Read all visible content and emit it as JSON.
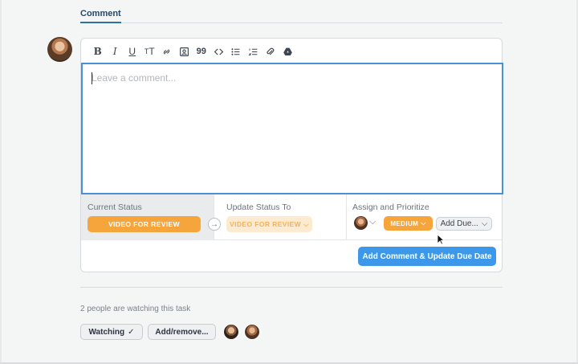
{
  "tabs": {
    "active": "Comment"
  },
  "toolbar": {
    "tools": [
      {
        "name": "bold-icon",
        "glyph": "B"
      },
      {
        "name": "italic-icon",
        "glyph": "I"
      },
      {
        "name": "underline-icon",
        "glyph": "U"
      },
      {
        "name": "text-size-icon",
        "glyph": "TT"
      },
      {
        "name": "link-icon",
        "glyph": "link"
      },
      {
        "name": "image-icon",
        "glyph": "img"
      },
      {
        "name": "quote-icon",
        "glyph": "99"
      },
      {
        "name": "code-icon",
        "glyph": "<>"
      },
      {
        "name": "bullet-list-icon",
        "glyph": "ul"
      },
      {
        "name": "numbered-list-icon",
        "glyph": "ol"
      },
      {
        "name": "attachment-icon",
        "glyph": "clip"
      },
      {
        "name": "google-drive-icon",
        "glyph": "drive"
      }
    ]
  },
  "editor": {
    "placeholder": "Leave a comment..."
  },
  "status": {
    "current_label": "Current Status",
    "current_value": "VIDEO FOR REVIEW",
    "update_label": "Update Status To",
    "update_value": "VIDEO FOR REVIEW",
    "assign_label": "Assign and Prioritize",
    "priority": "MEDIUM",
    "due": "Add Due..."
  },
  "actions": {
    "submit": "Add Comment & Update Due Date"
  },
  "watchers": {
    "text": "2 people are watching this task",
    "watching_button": "Watching",
    "add_remove_button": "Add/remove..."
  },
  "colors": {
    "accent": "#3d98ea",
    "status_orange": "#f6a53c",
    "status_light": "#fdebd1",
    "tab_underline": "#2f6fa8"
  }
}
